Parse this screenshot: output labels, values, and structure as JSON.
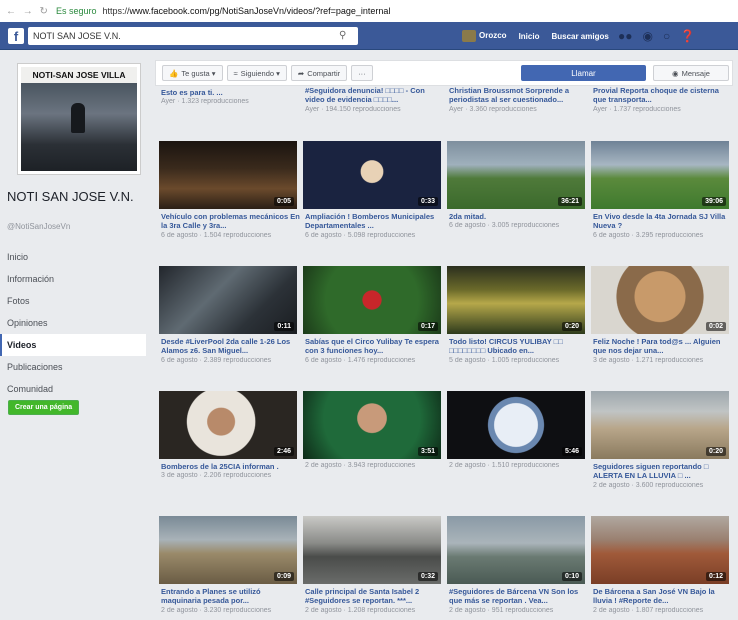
{
  "browser": {
    "nav_icons": "← → ↻",
    "secure_label": "Es seguro",
    "url_prefix": "https://",
    "url": "www.facebook.com/pg/NotiSanJoseVn/videos/?ref=page_internal"
  },
  "topbar": {
    "search_value": "NOTI SAN JOSE V.N.",
    "user_name": "Orozco",
    "links": [
      "Inicio",
      "Buscar amigos"
    ],
    "icons": [
      "friends-icon",
      "messages-icon",
      "globe-icon",
      "help-icon"
    ]
  },
  "sidebar": {
    "profile_banner": "NOTI-SAN JOSE VILLA",
    "page_name": "NOTI SAN JOSE V.N.",
    "handle": "@NotiSanJoseVn",
    "nav": [
      "Inicio",
      "Información",
      "Fotos",
      "Opiniones",
      "Videos",
      "Publicaciones",
      "Comunidad"
    ],
    "active_nav": "Videos",
    "create_page": "Crear una página"
  },
  "actionbar": {
    "like": "Te gusta ▾",
    "follow": "Siguiendo ▾",
    "share": "Compartir",
    "more": "···",
    "call": "Llamar",
    "message": "Mensaje"
  },
  "videos_top": [
    {
      "title": "Esto es para ti. ...",
      "meta": "Ayer · 1.323 reproducciones"
    },
    {
      "title": "#Seguidora denuncia! □□□□ - Con video de evidencia  □□□□...",
      "meta": "Ayer · 194.150 reproducciones"
    },
    {
      "title": "Christian Broussmot Sorprende a periodistas al ser cuestionado...",
      "meta": "Ayer · 3.360 reproducciones"
    },
    {
      "title": "Provial Reporta choque de cisterna que transporta...",
      "meta": "Ayer · 1.737 reproducciones"
    }
  ],
  "videos": [
    {
      "title": "Vehículo con problemas mecánicos En la 3ra Calle y 3ra...",
      "meta": "6 de agosto · 1.504 reproducciones",
      "duration": "0:05"
    },
    {
      "title": "Ampliación ! Bomberos Municipales Departamentales ...",
      "meta": "6 de agosto · 5.098 reproducciones",
      "duration": "0:33"
    },
    {
      "title": "2da mitad.",
      "meta": "6 de agosto · 3.005 reproducciones",
      "duration": "36:21"
    },
    {
      "title": "En Vivo desde la 4ta Jornada SJ Villa Nueva ?",
      "meta": "6 de agosto · 3.295 reproducciones",
      "duration": "39:06"
    },
    {
      "title": "Desde #LiverPool 2da calle 1-26 Los Alamos z6. San Miguel...",
      "meta": "6 de agosto · 2.389 reproducciones",
      "duration": "0:11"
    },
    {
      "title": "Sabías que el Circo Yulibay Te espera con 3 funciones hoy...",
      "meta": "6 de agosto · 1.476 reproducciones",
      "duration": "0:17"
    },
    {
      "title": "Todo listo! CIRCUS YULIBAY □□ □□□□□□□□ Ubicado en...",
      "meta": "5 de agosto · 1.005 reproducciones",
      "duration": "0:20"
    },
    {
      "title": "Feliz Noche ! Para tod@s ... Alguien que nos dejar una...",
      "meta": "3 de agosto · 1.271 reproducciones",
      "duration": "0:02"
    },
    {
      "title": "Bomberos de la 25CIA informan .",
      "meta": "3 de agosto · 2.206 reproducciones",
      "duration": "2:46"
    },
    {
      "title": "",
      "meta": "2 de agosto · 3.943 reproducciones",
      "duration": "3:51"
    },
    {
      "title": "",
      "meta": "2 de agosto · 1.510 reproducciones",
      "duration": "5:46"
    },
    {
      "title": "Seguidores siguen reportando □ ALERTA EN LA LLUVIA □ ...",
      "meta": "2 de agosto · 3.600 reproducciones",
      "duration": "0:20"
    },
    {
      "title": "Entrando a Planes se utilizó maquinaria pesada por...",
      "meta": "2 de agosto · 3.230 reproducciones",
      "duration": "0:09"
    },
    {
      "title": "Calle principal de Santa Isabel 2 #Seguidores se reportan. ***...",
      "meta": "2 de agosto · 1.208 reproducciones",
      "duration": "0:32"
    },
    {
      "title": "#Seguidores de Bárcena VN Son los que más se reportan . Vea...",
      "meta": "2 de agosto · 951 reproducciones",
      "duration": "0:10"
    },
    {
      "title": "De Bárcena a San José VN Bajo la lluvia ! #Reporte de...",
      "meta": "2 de agosto · 1.807 reproducciones",
      "duration": "0:12"
    }
  ]
}
